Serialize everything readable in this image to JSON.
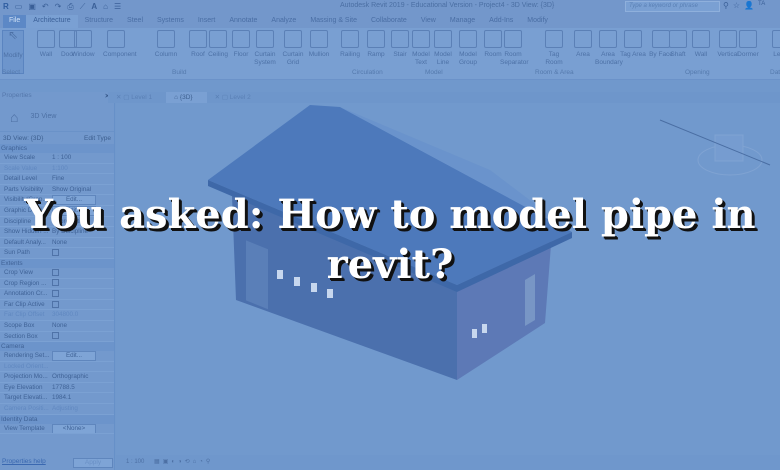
{
  "app": {
    "title": "Autodesk Revit 2019 - Educational Version - Project4 - 3D View: {3D}",
    "search_placeholder": "Type a keyword or phrase",
    "user": "TA"
  },
  "menu_tabs": [
    "File",
    "Architecture",
    "Structure",
    "Steel",
    "Systems",
    "Insert",
    "Annotate",
    "Analyze",
    "Massing & Site",
    "Collaborate",
    "View",
    "Manage",
    "Add-Ins",
    "Modify"
  ],
  "ribbon": {
    "tools": [
      "Modify",
      "Wall",
      "Door",
      "Window",
      "Component",
      "Column",
      "Roof",
      "Ceiling",
      "Floor",
      "Curtain System",
      "Curtain Grid",
      "Mullion",
      "Railing",
      "Ramp",
      "Stair",
      "Model Text",
      "Model Line",
      "Model Group",
      "Room",
      "Room Separator",
      "Tag Room",
      "Area",
      "Area Boundary",
      "Tag Area",
      "By Face",
      "Shaft",
      "Wall",
      "Vertical",
      "Dormer",
      "Level"
    ],
    "groups": [
      "Select",
      "Build",
      "Circulation",
      "Model",
      "Room & Area",
      "Opening",
      "Datum"
    ]
  },
  "properties": {
    "title": "Properties",
    "type": "3D View",
    "view_selector": "3D View: {3D}",
    "edit_type": "Edit Type",
    "sections": [
      {
        "name": "Graphics",
        "rows": [
          {
            "k": "View Scale",
            "v": "1 : 100"
          },
          {
            "k": "Scale Value",
            "v": "1:100",
            "dim": true
          },
          {
            "k": "Detail Level",
            "v": "Fine"
          },
          {
            "k": "Parts Visibility",
            "v": "Show Original"
          },
          {
            "k": "Visibility/Grap...",
            "v": "Edit...",
            "btn": true
          },
          {
            "k": "Graphic Displ...",
            "v": "Edit...",
            "btn": true
          },
          {
            "k": "Discipline",
            "v": "Coordination"
          },
          {
            "k": "Show Hidden ...",
            "v": "By Discipline"
          },
          {
            "k": "Default Analy...",
            "v": "None"
          },
          {
            "k": "Sun Path",
            "cb": true
          }
        ]
      },
      {
        "name": "Extents",
        "rows": [
          {
            "k": "Crop View",
            "cb": true
          },
          {
            "k": "Crop Region ...",
            "cb": true
          },
          {
            "k": "Annotation Cr...",
            "cb": true
          },
          {
            "k": "Far Clip Active",
            "cb": true
          },
          {
            "k": "Far Clip Offset",
            "v": "304800.0",
            "dim": true
          },
          {
            "k": "Scope Box",
            "v": "None"
          },
          {
            "k": "Section Box",
            "cb": true
          }
        ]
      },
      {
        "name": "Camera",
        "rows": [
          {
            "k": "Rendering Set...",
            "v": "Edit...",
            "btn": true
          },
          {
            "k": "Locked Orient...",
            "dim": true
          },
          {
            "k": "Projection Mo...",
            "v": "Orthographic"
          },
          {
            "k": "Eye Elevation",
            "v": "17788.5"
          },
          {
            "k": "Target Elevati...",
            "v": "1984.1"
          },
          {
            "k": "Camera Positi...",
            "v": "Adjusting",
            "dim": true
          }
        ]
      },
      {
        "name": "Identity Data",
        "rows": [
          {
            "k": "View Template",
            "v": "<None>",
            "btn": true
          }
        ]
      }
    ],
    "help": "Properties help",
    "apply": "Apply"
  },
  "view_tabs": [
    "Level 1",
    "{3D}",
    "Level 2"
  ],
  "status": {
    "scale": "1 : 100"
  },
  "headline": {
    "line1": "You asked: How to model pipe in",
    "line2": "revit?"
  }
}
